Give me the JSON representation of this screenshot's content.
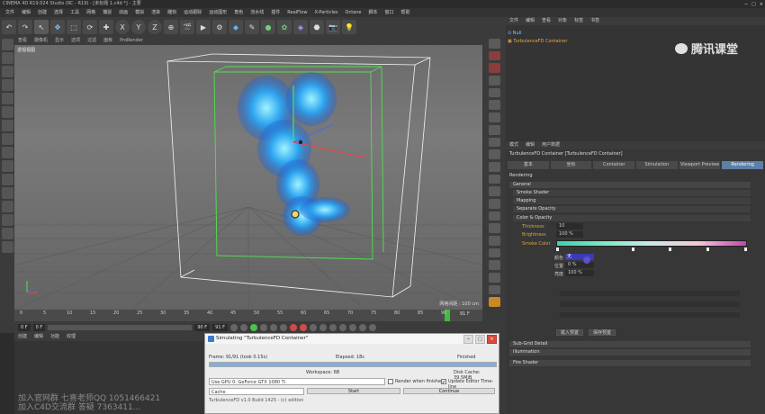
{
  "window": {
    "title": "CINEMA 4D R19.024 Studio (RC - R19) - [未标题 1.c4d *] - 主要",
    "controls": [
      "−",
      "□",
      "×"
    ]
  },
  "menubar": [
    "文件",
    "编辑",
    "创建",
    "选择",
    "工具",
    "网格",
    "捕捉",
    "动画",
    "模拟",
    "渲染",
    "雕刻",
    "运动跟踪",
    "运动图形",
    "角色",
    "流水线",
    "插件",
    "RealFlow",
    "X-Particles",
    "Octane",
    "脚本",
    "窗口",
    "帮助"
  ],
  "viewport": {
    "menu": [
      "查看",
      "摄像机",
      "显示",
      "选项",
      "过滤",
      "面板",
      "ProRender"
    ],
    "label": "透视视图",
    "grid_size": "网格间距 : 100 cm"
  },
  "timeline": {
    "ticks": [
      "0",
      "5",
      "10",
      "15",
      "20",
      "25",
      "30",
      "35",
      "40",
      "45",
      "50",
      "55",
      "60",
      "65",
      "70",
      "75",
      "80",
      "85",
      "90"
    ],
    "current_frame": "91 F",
    "end_frame": "91 F",
    "start_field": "0 F",
    "fps_field": "90 F"
  },
  "material_manager": {
    "menu": [
      "创建",
      "编辑",
      "功能",
      "纹理"
    ]
  },
  "object_manager": {
    "menu": [
      "文件",
      "编辑",
      "查看",
      "对象",
      "标签",
      "书签"
    ],
    "objects": [
      {
        "name": "Null"
      },
      {
        "name": "TurbulenceFD Container",
        "selected": true
      }
    ]
  },
  "watermark": "腾讯课堂",
  "attributes": {
    "menu": [
      "模式",
      "编辑",
      "用户数据"
    ],
    "title": "TurbulenceFD Container [TurbulenceFD Container]",
    "tabs": [
      {
        "label": "基本",
        "active": false
      },
      {
        "label": "坐标",
        "active": false
      },
      {
        "label": "Container",
        "active": false
      },
      {
        "label": "Simulation",
        "active": false
      },
      {
        "label": "Viewport Preview",
        "active": false
      },
      {
        "label": "Rendering",
        "active": true
      }
    ],
    "section_header": "Rendering",
    "sections": [
      "General",
      "Smoke Shader",
      "Mapping",
      "Separate Opacity",
      "Color & Opacity"
    ],
    "params": {
      "thickness_label": "Thickness",
      "thickness_value": "10",
      "brightness_label": "Brightness",
      "brightness_value": "100 %",
      "smoke_color_label": "Smoke Color"
    },
    "popup": {
      "row1_label": "颜色",
      "row1_value": "无",
      "row2_label": "位置",
      "row2_value": "0 %",
      "row3_label": "亮度",
      "row3_value": "100 %"
    },
    "preset_buttons": [
      "载入预置",
      "保存预置"
    ],
    "bottom_sections": [
      "Sub-Grid Detail",
      "Illumination",
      "Fire Shader"
    ],
    "gradient_colors": [
      "#39d3ad",
      "#7de8c8",
      "#cde7e6",
      "#f3c6d6",
      "#c245b0"
    ]
  },
  "sim_dialog": {
    "title": "Simulating \"TurbulenceFD Container\"",
    "frame_label": "Frame: 91/91 (took 0.15s)",
    "elapsed_label": "Elapsed: 18s",
    "status": "Finished",
    "progress": 1.0,
    "workspace": "Workspace: 6B",
    "disk_cache": "Disk Cache: 39.5MiB",
    "gpu_select": "Use GPU 0: GeForce GTX 1080 Ti",
    "render_when_finished": "Render when finished",
    "update_editor": "Update Editor Time-line",
    "cache_select": "Cache",
    "start_button": "Start",
    "continue_button": "Continue",
    "version": "TurbulenceFD v1.0 Build 1425 - (c) edition"
  },
  "overlay_text": [
    "加入官网群 七喜老师QQ 1051466421",
    "加入C4D交流群 答疑 7363411..."
  ]
}
